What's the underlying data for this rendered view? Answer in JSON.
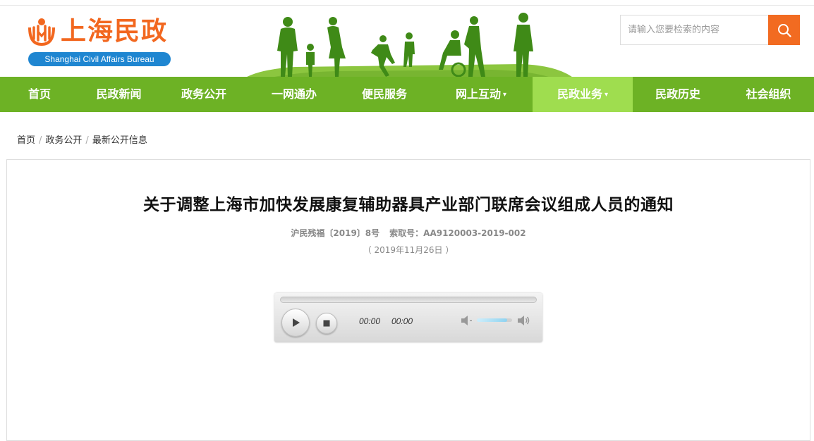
{
  "header": {
    "logo_cn": "上海民政",
    "logo_en": "Shanghai Civil Affairs Bureau",
    "colors": {
      "brand_orange": "#f2671f",
      "brand_blue": "#1f86d1",
      "banner_green": "#4a8a1c"
    }
  },
  "search": {
    "placeholder": "请输入您要检索的内容",
    "icon": "search-icon"
  },
  "nav": {
    "items": [
      {
        "label": "首页",
        "caret": ""
      },
      {
        "label": "民政新闻",
        "caret": ""
      },
      {
        "label": "政务公开",
        "caret": ""
      },
      {
        "label": "一网通办",
        "caret": ""
      },
      {
        "label": "便民服务",
        "caret": ""
      },
      {
        "label": "网上互动",
        "caret": "▾"
      },
      {
        "label": "民政业务",
        "caret": "▾",
        "active": true
      },
      {
        "label": "民政历史",
        "caret": ""
      },
      {
        "label": "社会组织",
        "caret": ""
      }
    ],
    "colors": {
      "bg": "#6db225",
      "active_bg": "#9fdd4f"
    }
  },
  "breadcrumb": {
    "items": [
      "首页",
      "政务公开",
      "最新公开信息"
    ],
    "separator": "/"
  },
  "article": {
    "title": "关于调整上海市加快发展康复辅助器具产业部门联席会议组成人员的通知",
    "doc_number": "沪民残福〔2019〕8号",
    "index_number": "索取号：AA9120003-2019-002",
    "date": "（ 2019年11月26日 ）"
  },
  "player": {
    "current_time": "00:00",
    "duration": "00:00",
    "volume": 0.85,
    "progress": 0,
    "icons": [
      "play-icon",
      "stop-icon",
      "volume-mute-icon",
      "volume-up-icon"
    ]
  }
}
